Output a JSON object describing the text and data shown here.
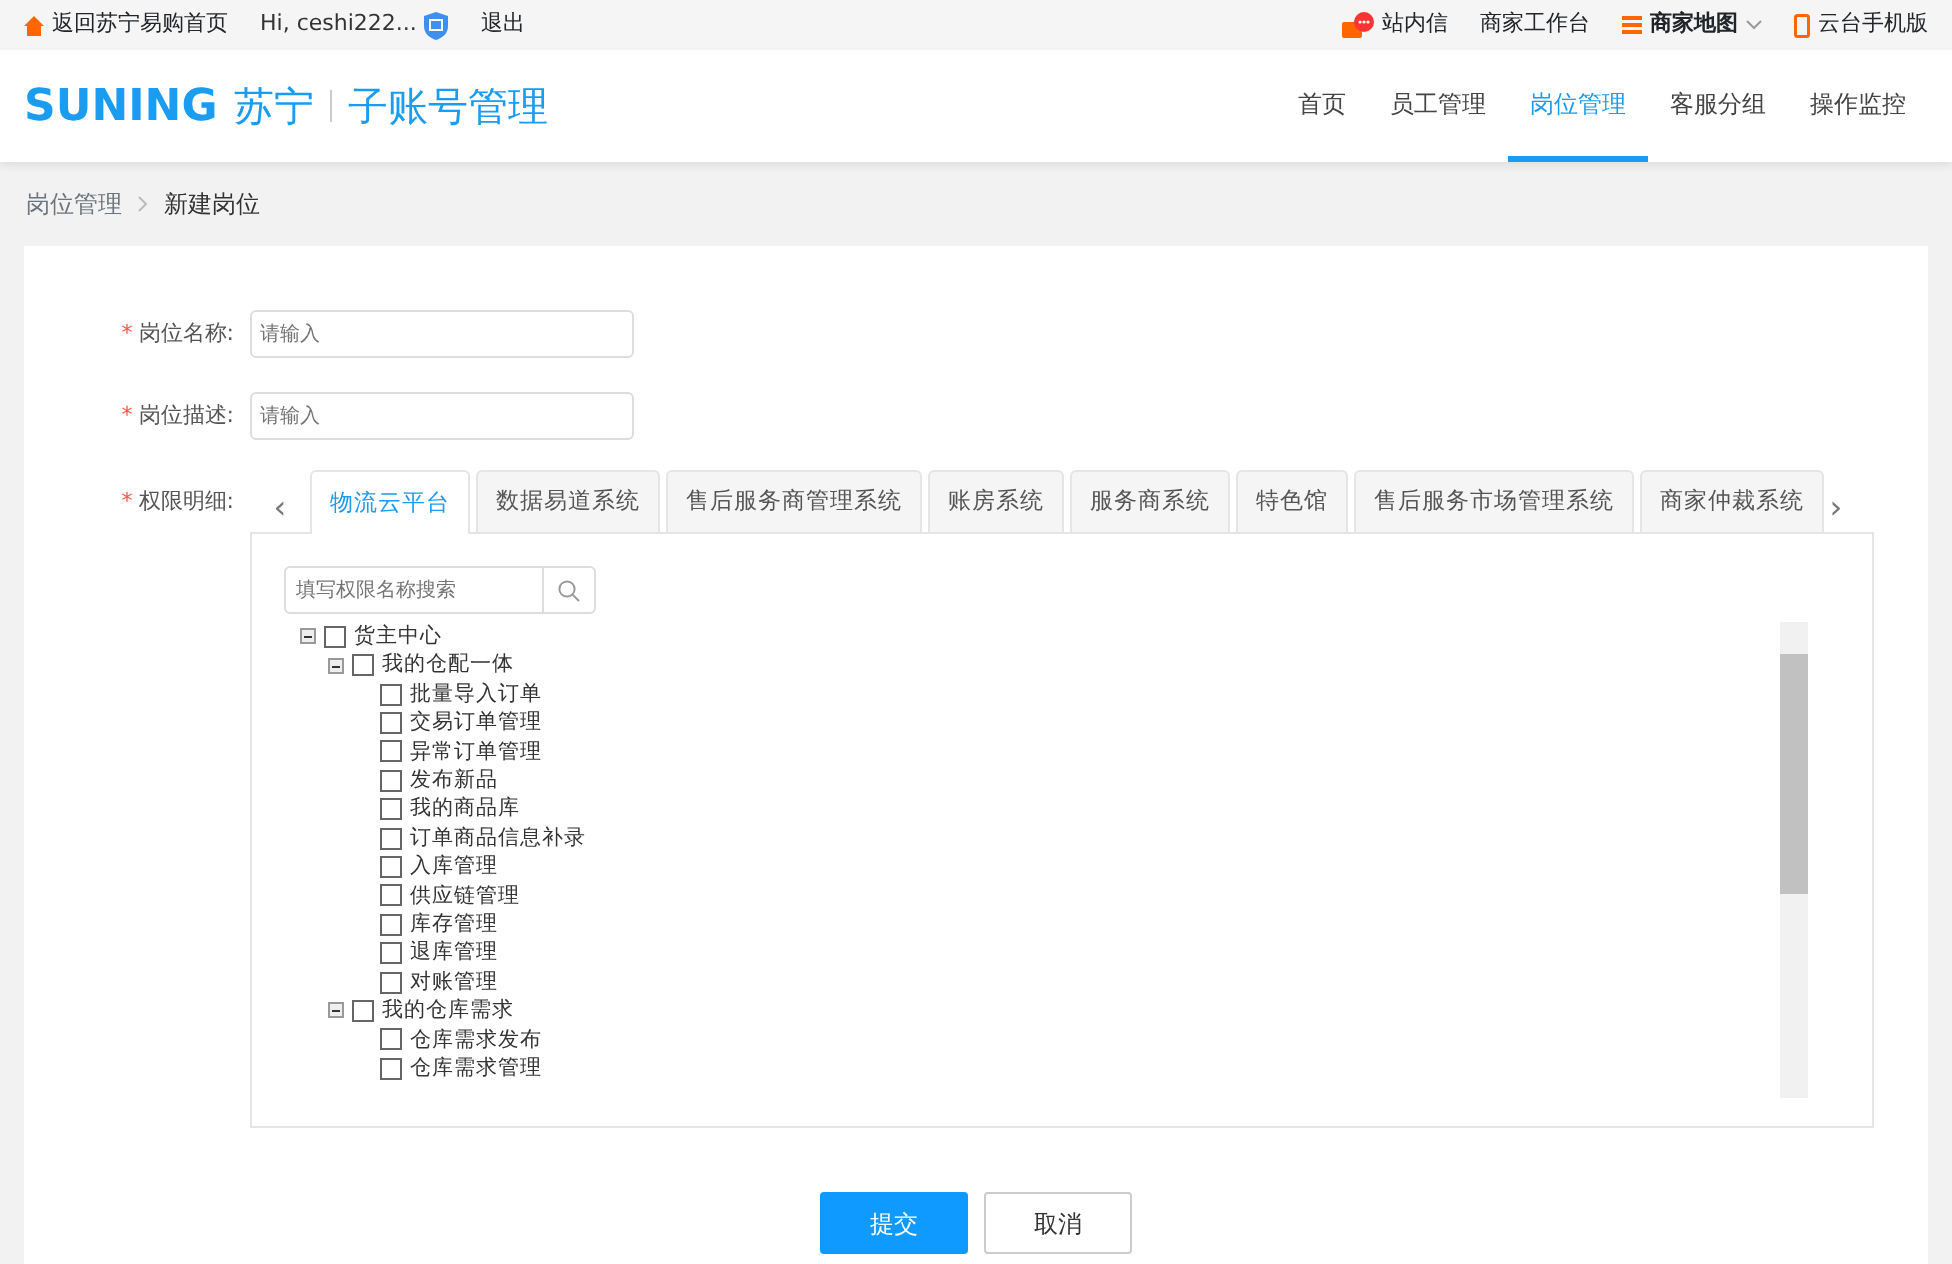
{
  "top_bar": {
    "home_link": "返回苏宁易购首页",
    "greeting": "Hi, ceshi222...",
    "logout": "退出",
    "messages": "站内信",
    "workbench": "商家工作台",
    "site_map": "商家地图",
    "mobile": "云台手机版"
  },
  "header": {
    "logo": "SUNING",
    "logo_cn": "苏宁",
    "title": "子账号管理"
  },
  "nav": [
    {
      "label": "首页",
      "selected": false
    },
    {
      "label": "员工管理",
      "selected": false
    },
    {
      "label": "岗位管理",
      "selected": true
    },
    {
      "label": "客服分组",
      "selected": false
    },
    {
      "label": "操作监控",
      "selected": false
    }
  ],
  "breadcrumb": [
    "岗位管理",
    "新建岗位"
  ],
  "form": {
    "name_label": "岗位名称:",
    "name_placeholder": "请输入",
    "desc_label": "岗位描述:",
    "desc_placeholder": "请输入",
    "permissions_label": "权限明细:",
    "required_mark": "*"
  },
  "tabs": [
    {
      "label": "物流云平台",
      "selected": true
    },
    {
      "label": "数据易道系统",
      "selected": false
    },
    {
      "label": "售后服务商管理系统",
      "selected": false
    },
    {
      "label": "账房系统",
      "selected": false
    },
    {
      "label": "服务商系统",
      "selected": false
    },
    {
      "label": "特色馆",
      "selected": false
    },
    {
      "label": "售后服务市场管理系统",
      "selected": false
    },
    {
      "label": "商家仲裁系统",
      "selected": false
    }
  ],
  "tab_prev": "‹",
  "tab_next": "›",
  "search": {
    "placeholder": "填写权限名称搜索"
  },
  "tree": [
    {
      "label": "货主中心",
      "checked": false,
      "expanded": true,
      "children": [
        {
          "label": "我的仓配一体",
          "checked": false,
          "expanded": true,
          "children": [
            {
              "label": "批量导入订单",
              "checked": false
            },
            {
              "label": "交易订单管理",
              "checked": false
            },
            {
              "label": "异常订单管理",
              "checked": false
            },
            {
              "label": "发布新品",
              "checked": false
            },
            {
              "label": "我的商品库",
              "checked": false
            },
            {
              "label": "订单商品信息补录",
              "checked": false
            },
            {
              "label": "入库管理",
              "checked": false
            },
            {
              "label": "供应链管理",
              "checked": false
            },
            {
              "label": "库存管理",
              "checked": false
            },
            {
              "label": "退库管理",
              "checked": false
            },
            {
              "label": "对账管理",
              "checked": false
            }
          ]
        },
        {
          "label": "我的仓库需求",
          "checked": false,
          "expanded": true,
          "children": [
            {
              "label": "仓库需求发布",
              "checked": false
            },
            {
              "label": "仓库需求管理",
              "checked": false
            }
          ]
        }
      ]
    }
  ],
  "buttons": {
    "submit": "提交",
    "cancel": "取消"
  }
}
